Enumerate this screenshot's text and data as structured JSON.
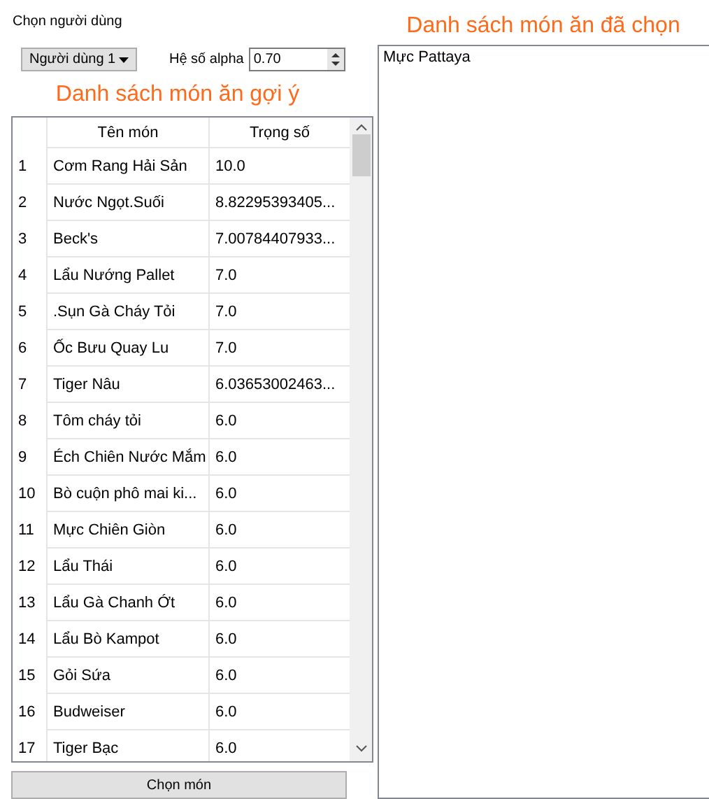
{
  "user_label": "Chọn người dùng",
  "user_select": {
    "value": "Người dùng 1"
  },
  "alpha": {
    "label": "Hệ số alpha",
    "value": "0.70"
  },
  "suggest_title": "Danh sách món ăn gợi ý",
  "table": {
    "columns": [
      "Tên món",
      "Trọng số"
    ],
    "rows": [
      {
        "index": "1",
        "name": "Cơm Rang Hải Sản",
        "weight": "10.0"
      },
      {
        "index": "2",
        "name": "Nước Ngọt.Suối",
        "weight": "8.82295393405..."
      },
      {
        "index": "3",
        "name": "Beck's",
        "weight": "7.00784407933..."
      },
      {
        "index": "4",
        "name": "Lẩu Nướng Pallet",
        "weight": "7.0"
      },
      {
        "index": "5",
        "name": ".Sụn Gà Cháy Tỏi",
        "weight": "7.0"
      },
      {
        "index": "6",
        "name": "Ốc Bưu Quay Lu",
        "weight": "7.0"
      },
      {
        "index": "7",
        "name": "Tiger Nâu",
        "weight": "6.03653002463..."
      },
      {
        "index": "8",
        "name": "Tôm cháy tỏi",
        "weight": "6.0"
      },
      {
        "index": "9",
        "name": "Éch Chiên Nước Mắm",
        "weight": "6.0"
      },
      {
        "index": "10",
        "name": "Bò cuộn phô mai ki...",
        "weight": "6.0"
      },
      {
        "index": "11",
        "name": "Mực Chiên Giòn",
        "weight": "6.0"
      },
      {
        "index": "12",
        "name": "Lẩu Thái",
        "weight": "6.0"
      },
      {
        "index": "13",
        "name": "Lẩu Gà Chanh Ớt",
        "weight": "6.0"
      },
      {
        "index": "14",
        "name": "Lẩu Bò Kampot",
        "weight": "6.0"
      },
      {
        "index": "15",
        "name": "Gỏi Sứa",
        "weight": "6.0"
      },
      {
        "index": "16",
        "name": "Budweiser",
        "weight": "6.0"
      },
      {
        "index": "17",
        "name": "Tiger Bạc",
        "weight": "6.0"
      }
    ]
  },
  "choose_button": "Chọn món",
  "chosen_title": "Danh sách món ăn đã chọn",
  "chosen_items": [
    "Mực Pattaya"
  ]
}
